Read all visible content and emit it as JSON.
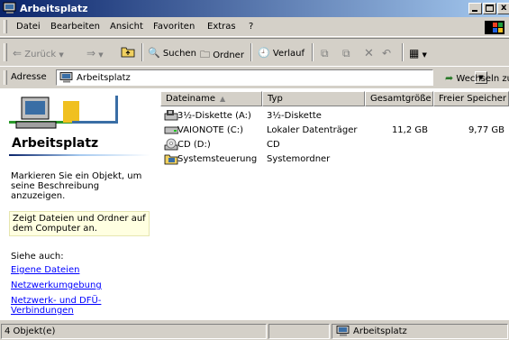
{
  "window": {
    "title": "Arbeitsplatz"
  },
  "menu": [
    "Datei",
    "Bearbeiten",
    "Ansicht",
    "Favoriten",
    "Extras",
    "?"
  ],
  "toolbar": {
    "back": "Zurück",
    "search": "Suchen",
    "folders": "Ordner",
    "history": "Verlauf"
  },
  "address": {
    "label": "Adresse",
    "value": "Arbeitsplatz",
    "go": "Wechseln zu"
  },
  "left_pane": {
    "title": "Arbeitsplatz",
    "hint": "Markieren Sie ein Objekt, um seine Beschreibung anzuzeigen.",
    "note": "Zeigt Dateien und Ordner auf dem Computer an.",
    "see_also": "Siehe auch:",
    "links": [
      "Eigene Dateien",
      "Netzwerkumgebung",
      "Netzwerk- und DFÜ-Verbindungen"
    ]
  },
  "columns": [
    "Dateiname",
    "Typ",
    "Gesamtgröße",
    "Freier Speicher"
  ],
  "rows": [
    {
      "name": "3½-Diskette (A:)",
      "type": "3½-Diskette",
      "size": "",
      "free": "",
      "icon": "floppy-drive-icon"
    },
    {
      "name": "VAIONOTE (C:)",
      "type": "Lokaler Datenträger",
      "size": "11,2 GB",
      "free": "9,77 GB",
      "icon": "hard-drive-icon"
    },
    {
      "name": "CD (D:)",
      "type": "CD",
      "size": "",
      "free": "",
      "icon": "cd-drive-icon"
    },
    {
      "name": "Systemsteuerung",
      "type": "Systemordner",
      "size": "",
      "free": "",
      "icon": "control-panel-icon"
    }
  ],
  "status": {
    "count": "4 Objekt(e)",
    "location": "Arbeitsplatz"
  }
}
